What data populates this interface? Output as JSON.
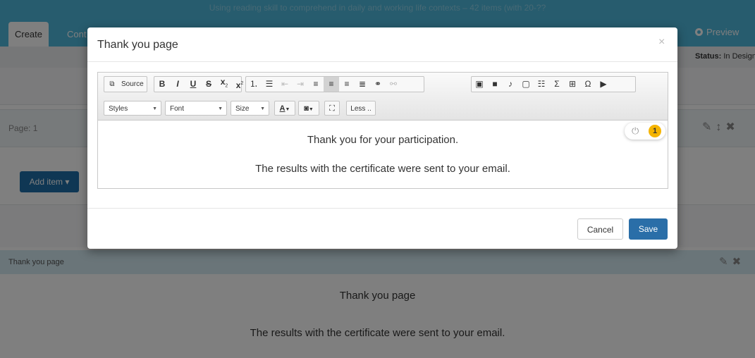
{
  "banner": {
    "line1": "Using reading skill to comprehend in daily and working life contexts – 42 items (with 20-??",
    "line2": ""
  },
  "tabs": [
    {
      "label": "Create"
    },
    {
      "label": "Cont"
    }
  ],
  "header": {
    "preview_label": "Preview",
    "status_label": "Status:",
    "status_value": "In Design"
  },
  "page": {
    "label": "Page: 1",
    "add_item_label": "Add item ▾"
  },
  "thank_you_section": {
    "label": "Thank you page",
    "line1": "Thank you page",
    "line2": "The results with the certificate were sent to your email."
  },
  "modal": {
    "title": "Thank you page",
    "close_glyph": "×",
    "cancel_label": "Cancel",
    "save_label": "Save"
  },
  "editor": {
    "source_label": "Source",
    "styles_label": "Styles",
    "font_label": "Font",
    "size_label": "Size",
    "less_label": "Less ..",
    "content_line1": "Thank you for your participation.",
    "content_line2": "The results with the certificate were sent to your email.",
    "badge_count": "1"
  },
  "colors": {
    "topbar": "#4fb8dc",
    "primary": "#2a6ea8",
    "badge": "#f5b400"
  }
}
